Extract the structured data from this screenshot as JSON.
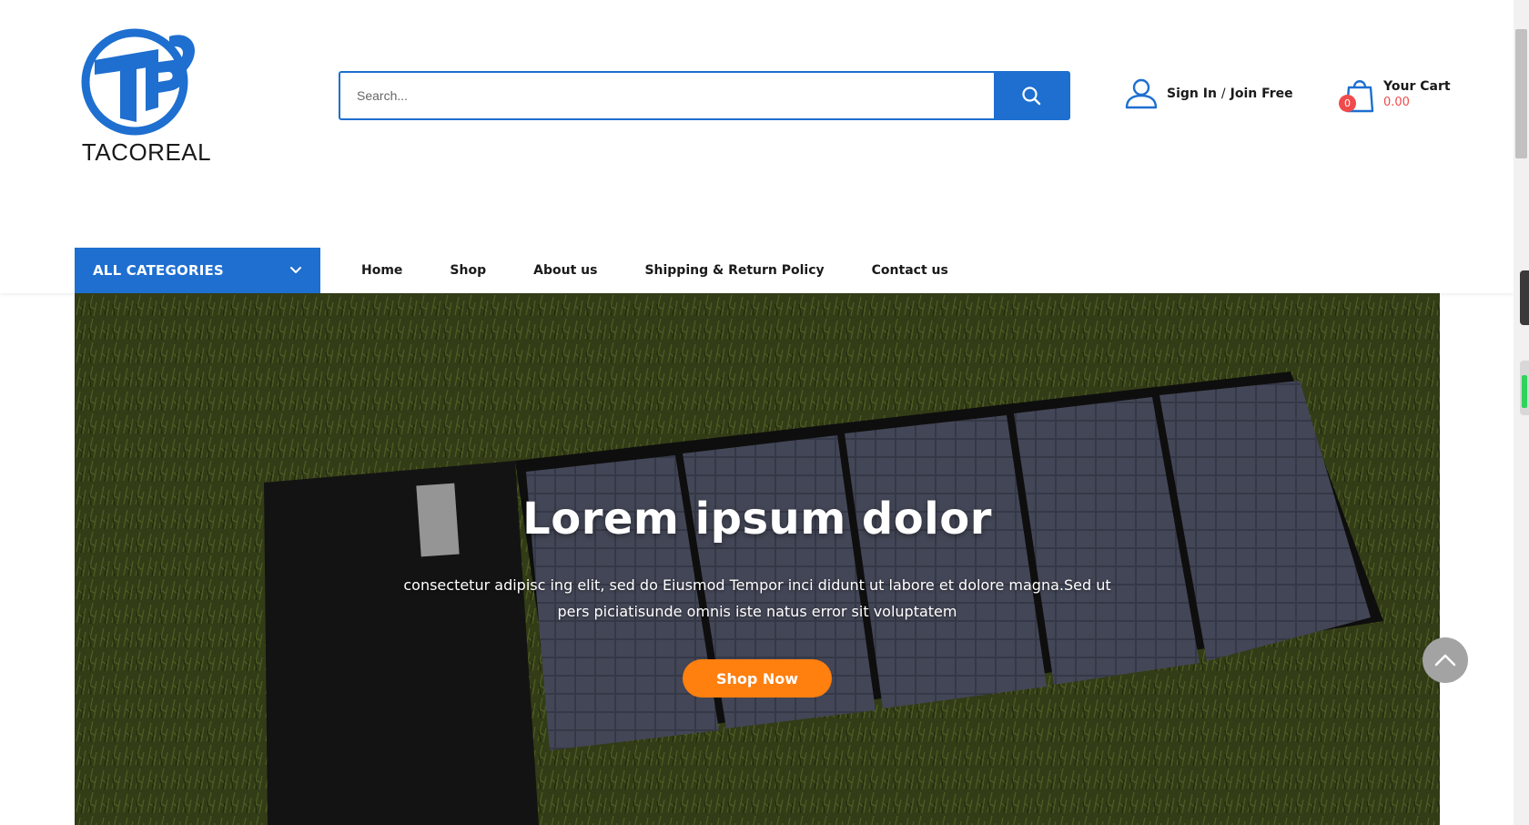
{
  "brand": {
    "name": "TACOREAL",
    "primary_color": "#1e6fd0",
    "accent_color": "#ff7f0f",
    "badge_color": "#f04b4b"
  },
  "header": {
    "search": {
      "placeholder": "Search...",
      "button_icon": "search-icon"
    },
    "account": {
      "icon": "user-icon",
      "sign_in": "Sign In",
      "separator": "/",
      "join": "Join Free"
    },
    "cart": {
      "icon": "shopping-bag-icon",
      "count": "0",
      "title": "Your Cart",
      "amount": "0.00"
    }
  },
  "nav": {
    "categories_label": "ALL CATEGORIES",
    "categories_icon": "chevron-down-icon",
    "items": [
      {
        "label": "Home"
      },
      {
        "label": "Shop"
      },
      {
        "label": "About us"
      },
      {
        "label": "Shipping & Return Policy"
      },
      {
        "label": "Contact us"
      }
    ]
  },
  "hero": {
    "title": "Lorem ipsum dolor",
    "subtitle": "consectetur adipisc ing elit, sed do Eiusmod Tempor inci didunt ut labore et dolore magna.Sed ut pers piciatisunde omnis iste natus error sit voluptatem",
    "button_label": "Shop Now",
    "image_subject": "folding solar panel on grass"
  },
  "scroll_top_icon": "chevron-up-icon"
}
